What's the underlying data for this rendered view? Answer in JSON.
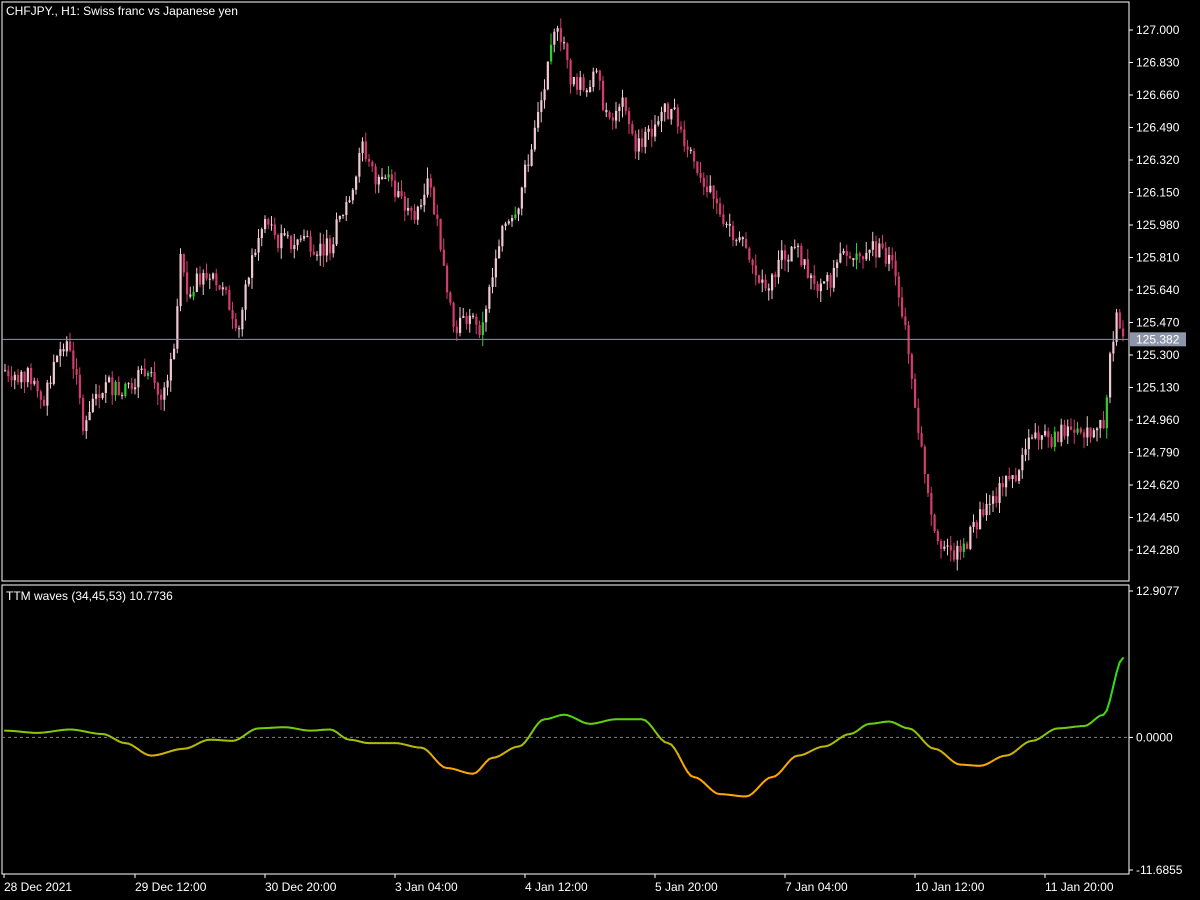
{
  "header": {
    "main_title": "CHFJPY., H1:  Swiss franc vs Japanese yen",
    "indicator_title": "TTM waves (34,45,53) 10.7736"
  },
  "colors": {
    "background": "#000000",
    "frame": "#ffffff",
    "bull_candle": "#32cd32",
    "bear_candle": "#d23c6e",
    "doji_candle": "#f0c8d2",
    "current_price_line": "#8c96a8",
    "current_price_box": "#8c96a8",
    "wave_negative": "#ffa500",
    "wave_positive": "#32dc14",
    "zero_line": "#7d7d7d"
  },
  "chart_data": [
    {
      "type": "candlestick",
      "symbol": "CHFJPY.",
      "timeframe": "H1",
      "title": "CHFJPY., H1:  Swiss franc vs Japanese yen",
      "ylim": [
        124.12,
        127.2
      ],
      "y_ticks": [
        "127.000",
        "126.830",
        "126.660",
        "126.490",
        "126.320",
        "126.150",
        "125.980",
        "125.810",
        "125.640",
        "125.470",
        "125.300",
        "125.130",
        "124.960",
        "124.790",
        "124.620",
        "124.450",
        "124.280"
      ],
      "current_price": 125.382,
      "current_price_label": "125.382",
      "x_ticks": [
        "28 Dec 2021",
        "29 Dec 12:00",
        "30 Dec 20:00",
        "3 Jan 04:00",
        "4 Jan 12:00",
        "5 Jan 20:00",
        "7 Jan 04:00",
        "10 Jan 12:00",
        "11 Jan 20:00"
      ],
      "close_path": [
        [
          0,
          125.22
        ],
        [
          8,
          125.18
        ],
        [
          12,
          125.05
        ],
        [
          16,
          125.3
        ],
        [
          20,
          125.35
        ],
        [
          24,
          124.95
        ],
        [
          28,
          125.1
        ],
        [
          32,
          125.15
        ],
        [
          36,
          125.1
        ],
        [
          40,
          125.18
        ],
        [
          44,
          125.25
        ],
        [
          48,
          125.05
        ],
        [
          52,
          125.3
        ],
        [
          54,
          125.8
        ],
        [
          56,
          125.62
        ],
        [
          60,
          125.7
        ],
        [
          64,
          125.72
        ],
        [
          68,
          125.6
        ],
        [
          72,
          125.45
        ],
        [
          76,
          125.8
        ],
        [
          80,
          126.0
        ],
        [
          84,
          125.9
        ],
        [
          88,
          125.88
        ],
        [
          92,
          125.92
        ],
        [
          96,
          125.86
        ],
        [
          100,
          125.88
        ],
        [
          104,
          126.05
        ],
        [
          108,
          126.25
        ],
        [
          110,
          126.4
        ],
        [
          114,
          126.2
        ],
        [
          118,
          126.25
        ],
        [
          122,
          126.1
        ],
        [
          126,
          126.0
        ],
        [
          130,
          126.25
        ],
        [
          134,
          125.9
        ],
        [
          138,
          125.45
        ],
        [
          142,
          125.5
        ],
        [
          146,
          125.42
        ],
        [
          150,
          125.7
        ],
        [
          154,
          126.0
        ],
        [
          158,
          126.1
        ],
        [
          162,
          126.4
        ],
        [
          166,
          126.7
        ],
        [
          170,
          127.05
        ],
        [
          174,
          126.75
        ],
        [
          178,
          126.7
        ],
        [
          182,
          126.75
        ],
        [
          186,
          126.5
        ],
        [
          190,
          126.6
        ],
        [
          194,
          126.4
        ],
        [
          198,
          126.45
        ],
        [
          202,
          126.58
        ],
        [
          206,
          126.55
        ],
        [
          210,
          126.4
        ],
        [
          214,
          126.25
        ],
        [
          218,
          126.1
        ],
        [
          222,
          126.0
        ],
        [
          226,
          125.9
        ],
        [
          230,
          125.75
        ],
        [
          234,
          125.62
        ],
        [
          238,
          125.8
        ],
        [
          242,
          125.85
        ],
        [
          246,
          125.8
        ],
        [
          250,
          125.6
        ],
        [
          254,
          125.7
        ],
        [
          258,
          125.82
        ],
        [
          262,
          125.8
        ],
        [
          266,
          125.88
        ],
        [
          270,
          125.82
        ],
        [
          274,
          125.75
        ],
        [
          278,
          125.3
        ],
        [
          282,
          124.8
        ],
        [
          286,
          124.4
        ],
        [
          290,
          124.26
        ],
        [
          294,
          124.25
        ],
        [
          298,
          124.4
        ],
        [
          302,
          124.5
        ],
        [
          306,
          124.6
        ],
        [
          310,
          124.65
        ],
        [
          314,
          124.8
        ],
        [
          318,
          124.9
        ],
        [
          322,
          124.85
        ],
        [
          326,
          124.9
        ],
        [
          330,
          124.95
        ],
        [
          334,
          124.85
        ],
        [
          338,
          124.95
        ],
        [
          340,
          125.3
        ],
        [
          342,
          125.5
        ],
        [
          344,
          125.38
        ]
      ]
    },
    {
      "type": "line",
      "title": "TTM waves (34,45,53) 10.7736",
      "ylim": [
        -11.6855,
        12.9077
      ],
      "y_ticks": [
        "12.9077",
        "0.0000",
        "-11.6855"
      ],
      "zero_line": true,
      "series": [
        {
          "values": [
            [
              0,
              0.6
            ],
            [
              10,
              0.4
            ],
            [
              20,
              0.7
            ],
            [
              30,
              0.3
            ],
            [
              37,
              -0.5
            ],
            [
              45,
              -1.6
            ],
            [
              55,
              -1.0
            ],
            [
              63,
              -0.2
            ],
            [
              70,
              -0.3
            ],
            [
              78,
              0.8
            ],
            [
              86,
              0.9
            ],
            [
              94,
              0.6
            ],
            [
              100,
              0.7
            ],
            [
              106,
              -0.2
            ],
            [
              112,
              -0.5
            ],
            [
              120,
              -0.5
            ],
            [
              128,
              -0.9
            ],
            [
              136,
              -2.7
            ],
            [
              144,
              -3.2
            ],
            [
              150,
              -1.8
            ],
            [
              158,
              -0.8
            ],
            [
              166,
              1.6
            ],
            [
              172,
              2.0
            ],
            [
              180,
              1.2
            ],
            [
              188,
              1.6
            ],
            [
              196,
              1.6
            ],
            [
              204,
              -0.5
            ],
            [
              212,
              -3.5
            ],
            [
              220,
              -5.0
            ],
            [
              228,
              -5.2
            ],
            [
              236,
              -3.5
            ],
            [
              244,
              -1.6
            ],
            [
              252,
              -0.8
            ],
            [
              260,
              0.3
            ],
            [
              266,
              1.2
            ],
            [
              272,
              1.4
            ],
            [
              278,
              0.8
            ],
            [
              286,
              -1.0
            ],
            [
              294,
              -2.4
            ],
            [
              300,
              -2.5
            ],
            [
              308,
              -1.6
            ],
            [
              316,
              -0.3
            ],
            [
              324,
              0.8
            ],
            [
              332,
              1.0
            ],
            [
              338,
              2.0
            ],
            [
              344,
              7.0
            ]
          ]
        }
      ]
    }
  ]
}
